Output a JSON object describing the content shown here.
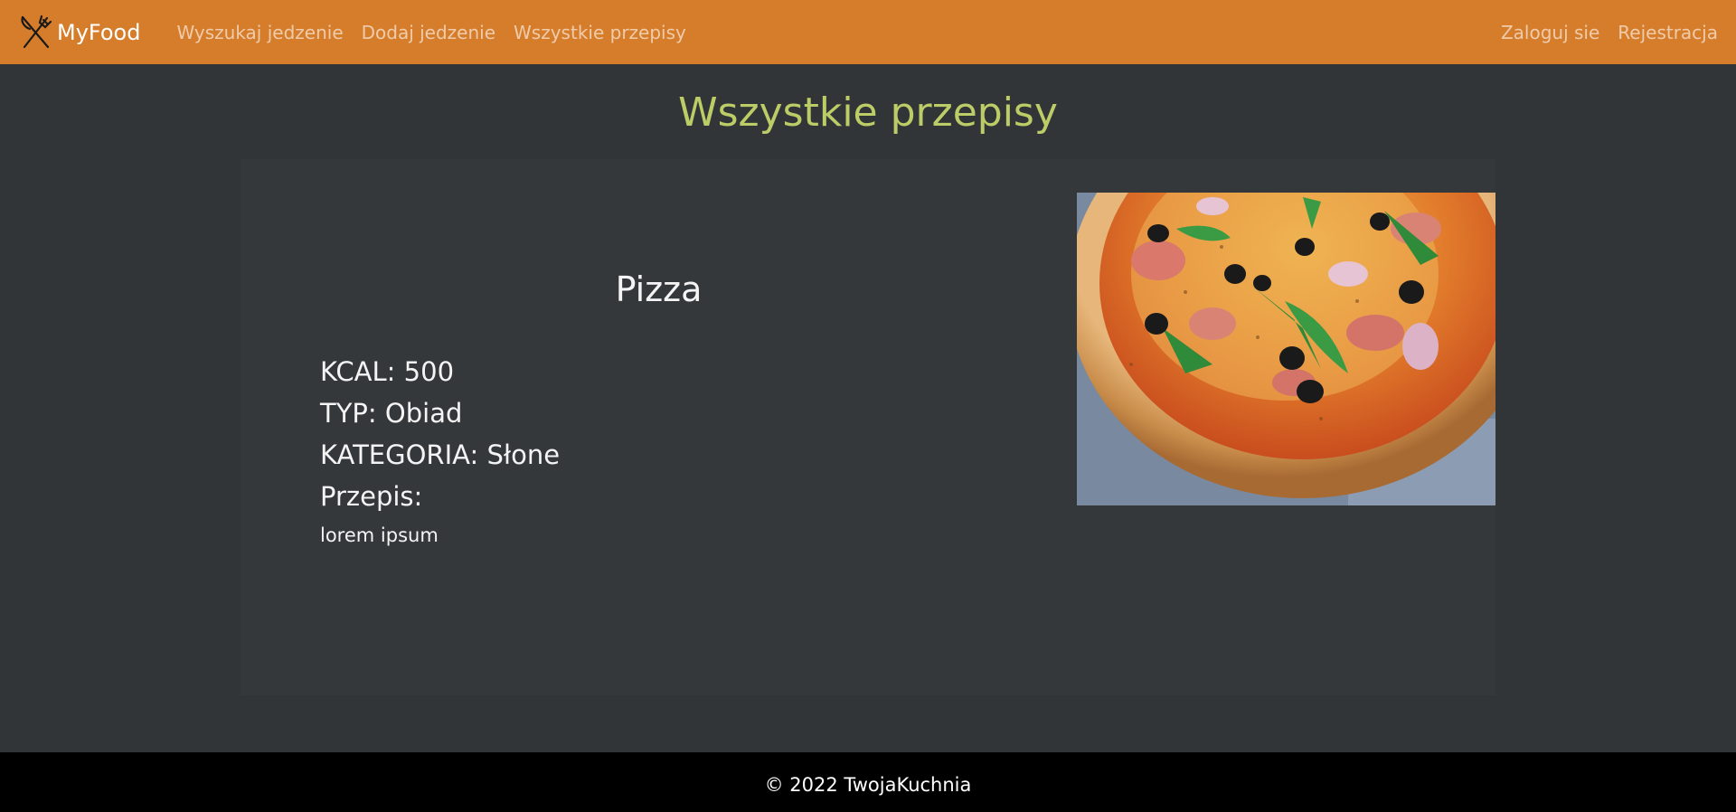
{
  "navbar": {
    "brand": "MyFood",
    "brand_icon": "fork-knife-icon",
    "color": "#d67d2b",
    "left_links": [
      "Wyszukaj jedzenie",
      "Dodaj jedzenie",
      "Wszystkie przepisy"
    ],
    "right_links": [
      "Zaloguj sie",
      "Rejestracja"
    ]
  },
  "page": {
    "title": "Wszystkie przepisy",
    "title_color": "#bccc66"
  },
  "recipe": {
    "name": "Pizza",
    "kcal": "KCAL: 500",
    "type": "TYP: Obiad",
    "category": "KATEGORIA: Słone",
    "recipe_label": "Przepis:",
    "recipe_text": "lorem ipsum",
    "image": "pizza-photo"
  },
  "footer": {
    "text": "© 2022 TwojaKuchnia"
  }
}
